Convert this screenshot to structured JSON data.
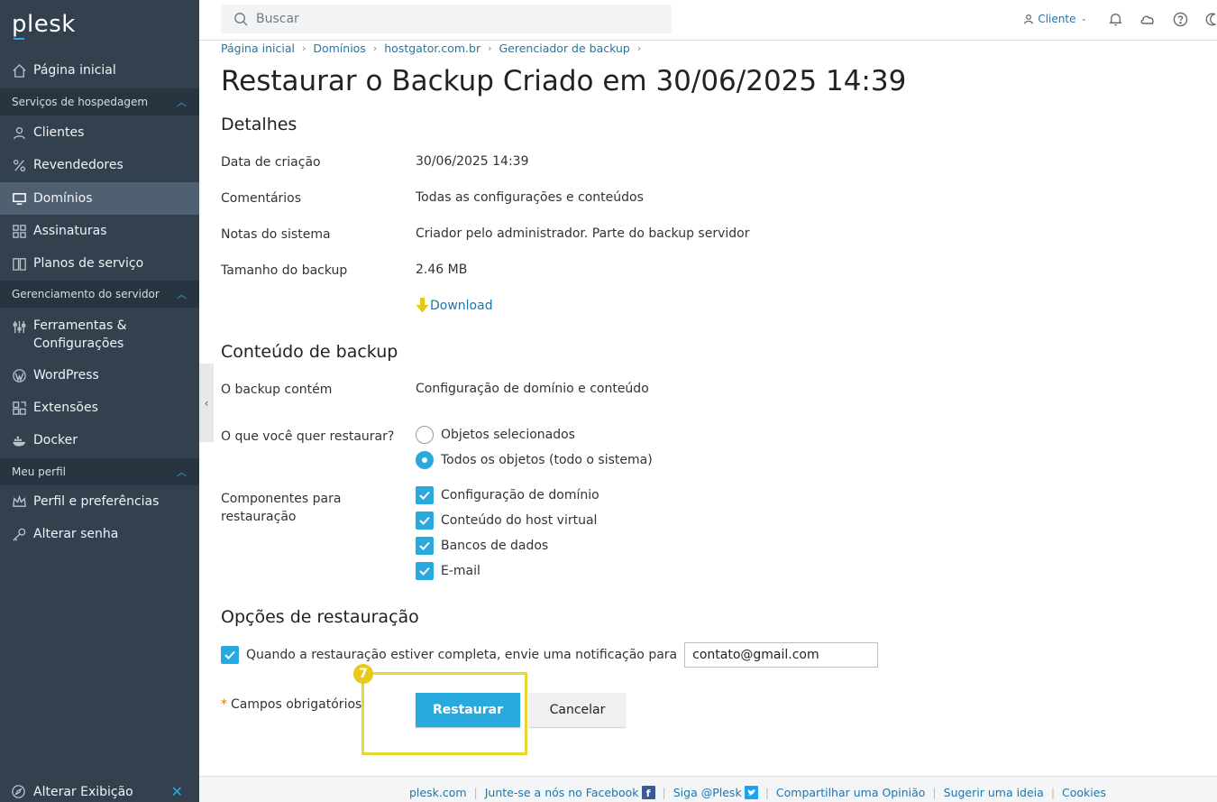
{
  "app": {
    "logo": "plesk"
  },
  "search": {
    "placeholder": "Buscar"
  },
  "user": {
    "label": "Cliente"
  },
  "sidebar": {
    "home": "Página inicial",
    "sections": {
      "hosting": "Serviços de hospedagem",
      "server": "Gerenciamento do servidor",
      "profile": "Meu perfil"
    },
    "items": {
      "clients": "Clientes",
      "resellers": "Revendedores",
      "domains": "Domínios",
      "subscriptions": "Assinaturas",
      "plans": "Planos de serviço",
      "tools_line1": "Ferramentas &",
      "tools_line2": "Configurações",
      "wordpress": "WordPress",
      "extensions": "Extensões",
      "docker": "Docker",
      "profile_prefs": "Perfil e preferências",
      "change_password": "Alterar senha"
    },
    "bottom": "Alterar Exibição"
  },
  "breadcrumb": [
    "Página inicial",
    "Domínios",
    "hostgator.com.br",
    "Gerenciador de backup"
  ],
  "page_title": "Restaurar o Backup Criado em 30/06/2025 14:39",
  "details": {
    "title": "Detalhes",
    "creation_label": "Data de criação",
    "creation_value": "30/06/2025 14:39",
    "comments_label": "Comentários",
    "comments_value": "Todas as configurações e conteúdos",
    "notes_label": "Notas do sistema",
    "notes_value": "Criador pelo administrador. Parte do backup servidor",
    "size_label": "Tamanho do backup",
    "size_value": "2.46 MB",
    "download": "Download"
  },
  "content": {
    "title": "Conteúdo de backup",
    "contains_label": "O backup contém",
    "contains_value": "Configuração de domínio e conteúdo",
    "restore_label": "O que você quer restaurar?",
    "radio_selected_objects": "Objetos selecionados",
    "radio_all_objects": "Todos os objetos (todo o sistema)",
    "components_label_line1": "Componentes para",
    "components_label_line2": "restauração",
    "components": [
      "Configuração de domínio",
      "Conteúdo do host virtual",
      "Bancos de dados",
      "E-mail"
    ]
  },
  "options": {
    "title": "Opções de restauração",
    "notify_label": "Quando a restauração estiver completa, envie uma notificação para",
    "notify_email": "contato@gmail.com"
  },
  "form": {
    "required_star": "*",
    "required_note": "Campos obrigatórios",
    "restore_button": "Restaurar",
    "cancel_button": "Cancelar",
    "step_badge": "7"
  },
  "footer": {
    "links": [
      "plesk.com",
      "Junte-se a nós no Facebook",
      "Siga @Plesk",
      "Compartilhar uma Opinião",
      "Sugerir uma ideia",
      "Cookies"
    ]
  },
  "colors": {
    "accent": "#28aade",
    "sidebar": "#33414f",
    "highlight": "#e9d534",
    "link": "#1f76a8"
  }
}
